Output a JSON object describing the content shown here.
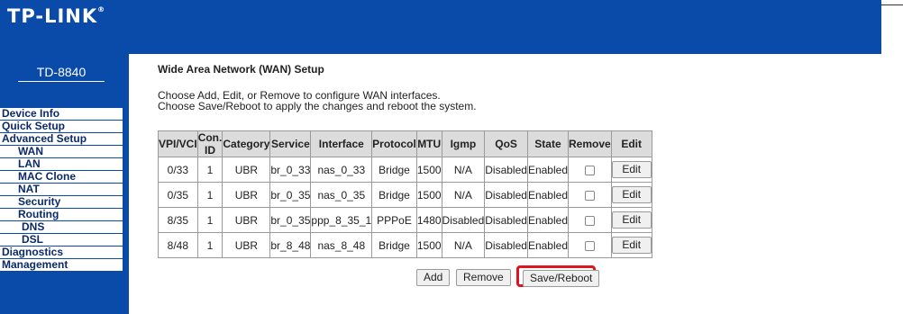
{
  "brand": "TP-LINK",
  "model": "TD-8840",
  "menu": [
    {
      "label": "Device Info",
      "level": 0
    },
    {
      "label": "Quick Setup",
      "level": 0
    },
    {
      "label": "Advanced Setup",
      "level": 0
    },
    {
      "label": "WAN",
      "level": 1
    },
    {
      "label": "LAN",
      "level": 1
    },
    {
      "label": "MAC Clone",
      "level": 1
    },
    {
      "label": "NAT",
      "level": 1
    },
    {
      "label": "Security",
      "level": 1
    },
    {
      "label": "Routing",
      "level": 1
    },
    {
      "label": "DNS",
      "level": 1
    },
    {
      "label": "DSL",
      "level": 1
    },
    {
      "label": "Diagnostics",
      "level": 0
    },
    {
      "label": "Management",
      "level": 0
    }
  ],
  "page": {
    "title": "Wide Area Network (WAN) Setup",
    "desc1": "Choose Add, Edit, or Remove to configure WAN interfaces.",
    "desc2": "Choose Save/Reboot to apply the changes and reboot the system."
  },
  "table": {
    "headers": [
      "VPI/VCI",
      "Con. ID",
      "Category",
      "Service",
      "Interface",
      "Protocol",
      "MTU",
      "Igmp",
      "QoS",
      "State",
      "Remove",
      "Edit"
    ],
    "rows": [
      [
        "0/33",
        "1",
        "UBR",
        "br_0_33",
        "nas_0_33",
        "Bridge",
        "1500",
        "N/A",
        "Disabled",
        "Enabled"
      ],
      [
        "0/35",
        "1",
        "UBR",
        "br_0_35",
        "nas_0_35",
        "Bridge",
        "1500",
        "N/A",
        "Disabled",
        "Enabled"
      ],
      [
        "8/35",
        "1",
        "UBR",
        "br_0_35",
        "ppp_8_35_1",
        "PPPoE",
        "1480",
        "Disabled",
        "Disabled",
        "Enabled"
      ],
      [
        "8/48",
        "1",
        "UBR",
        "br_8_48",
        "nas_8_48",
        "Bridge",
        "1500",
        "N/A",
        "Disabled",
        "Enabled"
      ]
    ],
    "edit_label": "Edit"
  },
  "buttons": {
    "add": "Add",
    "remove": "Remove",
    "save_reboot": "Save/Reboot"
  },
  "colors": {
    "brand_blue": "#0a4aa8",
    "highlight": "#e0141e"
  }
}
